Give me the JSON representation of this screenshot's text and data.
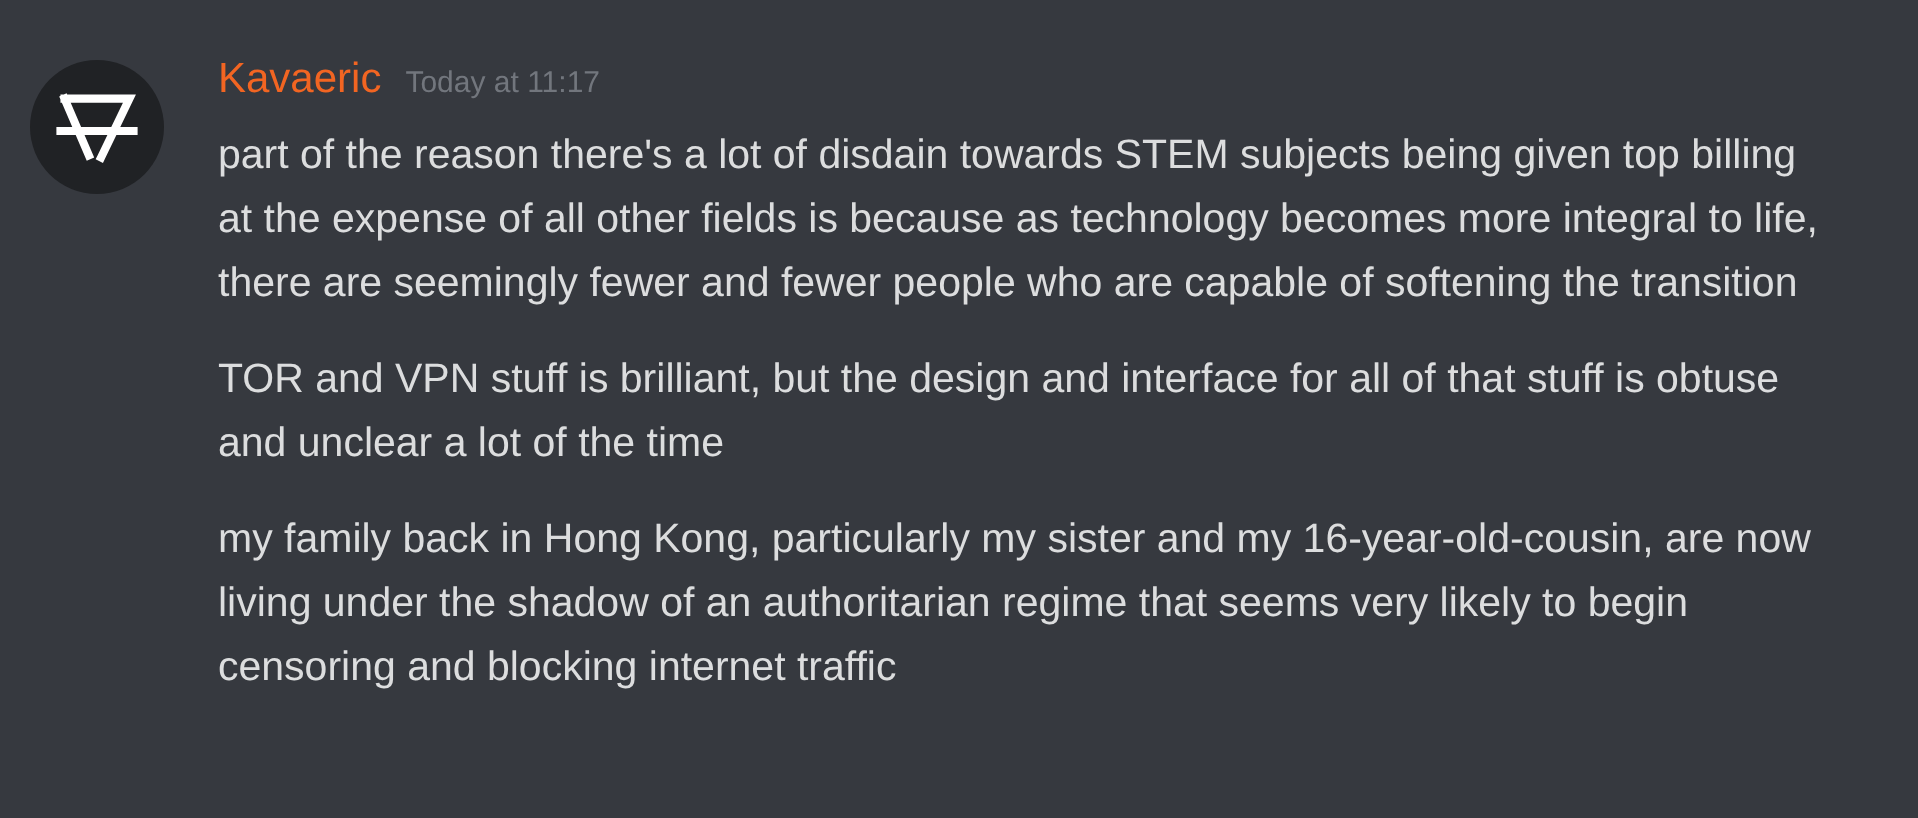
{
  "message_group": {
    "author": {
      "name": "Kavaeric",
      "color": "#f26522"
    },
    "timestamp": "Today at 11:17",
    "messages": [
      "part of the reason there's a lot of disdain towards STEM subjects being given top billing at the expense of all other fields is because as technology becomes more integral to life, there are seemingly fewer and fewer people who are capable of softening the transition",
      "TOR and VPN stuff is brilliant, but the design and interface for all of that stuff is obtuse and unclear a lot of the time",
      "my family back in Hong Kong, particularly my sister and my 16-year-old-cousin, are now living under the shadow of an authoritarian regime that seems very likely to begin censoring and blocking internet traffic"
    ]
  }
}
